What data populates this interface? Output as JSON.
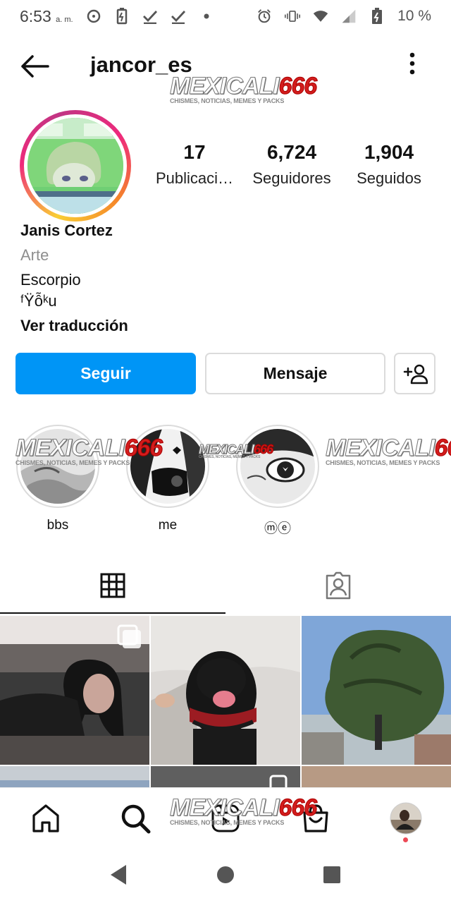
{
  "status_bar": {
    "time": "6:53",
    "ampm": "a. m.",
    "battery_percent": "10 %",
    "icons": [
      "chat-bubble-icon",
      "battery-saver-icon",
      "check-icon",
      "check-icon",
      "dot-icon",
      "alarm-icon",
      "vibrate-icon",
      "wifi-icon",
      "signal-icon",
      "battery-icon"
    ]
  },
  "header": {
    "username": "jancor_es",
    "icons": [
      "back-arrow-icon",
      "more-vertical-icon"
    ]
  },
  "watermark": {
    "title_prefix": "MEXICALI",
    "title_number": "666",
    "subtitle": "CHISMES, NOTICIAS, MEMES Y PACKS"
  },
  "profile": {
    "stats": [
      {
        "number": "17",
        "label": "Publicaci…"
      },
      {
        "number": "6,724",
        "label": "Seguidores"
      },
      {
        "number": "1,904",
        "label": "Seguidos"
      }
    ],
    "name": "Janis Cortez",
    "category": "Arte",
    "bio_lines": [
      "Escorpio",
      "ᶠŸỗᵏu"
    ],
    "translate_link": "Ver traducción"
  },
  "actions": {
    "follow_label": "Seguir",
    "message_label": "Mensaje",
    "add_user_icon": "add-user-icon"
  },
  "highlights": [
    {
      "label": "bbs"
    },
    {
      "label": "me"
    },
    {
      "label": "ⓜⓔ"
    }
  ],
  "tabs": [
    {
      "name": "grid",
      "icon": "grid-icon",
      "active": true
    },
    {
      "name": "tagged",
      "icon": "tagged-person-icon",
      "active": false
    }
  ],
  "bottom_nav": {
    "items": [
      "home-icon",
      "search-icon",
      "reels-icon",
      "shop-icon",
      "profile-avatar"
    ]
  },
  "colors": {
    "accent": "#0095f6",
    "border": "#dbdbdb",
    "muted_text": "#8e8e8e",
    "notification_dot": "#ed4956"
  }
}
